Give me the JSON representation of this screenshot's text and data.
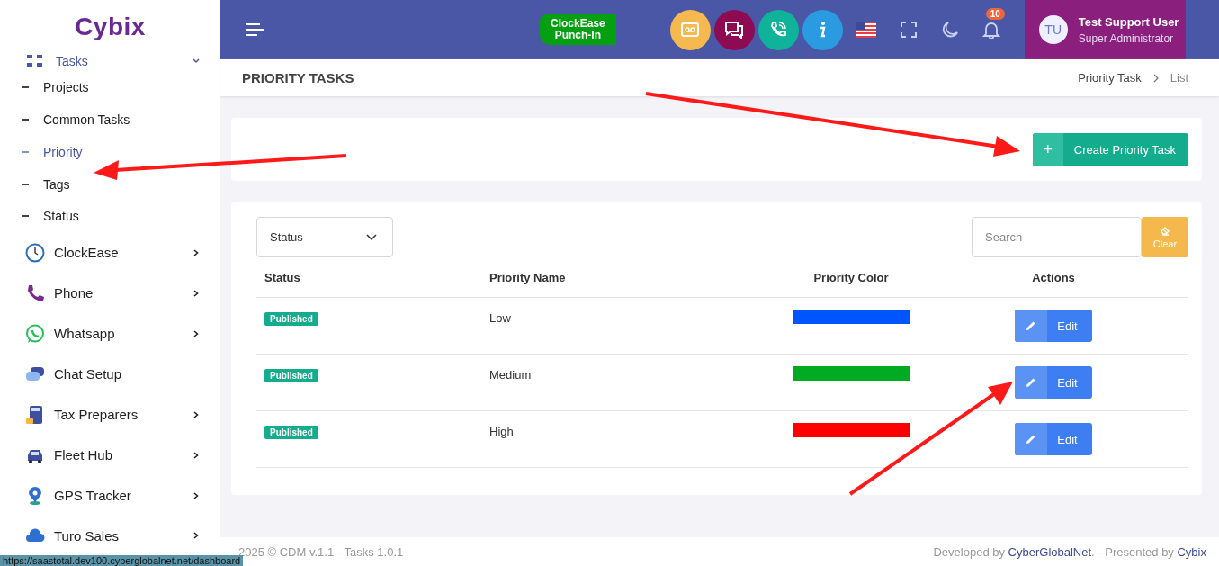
{
  "logo": "Cybix",
  "sidebar": {
    "group": {
      "label": "Tasks",
      "expanded": true,
      "children": [
        {
          "label": "Projects",
          "selected": false
        },
        {
          "label": "Common Tasks",
          "selected": false
        },
        {
          "label": "Priority",
          "selected": true
        },
        {
          "label": "Tags",
          "selected": false
        },
        {
          "label": "Status",
          "selected": false
        }
      ]
    },
    "items": [
      {
        "label": "ClockEase",
        "expandable": true
      },
      {
        "label": "Phone",
        "expandable": true
      },
      {
        "label": "Whatsapp",
        "expandable": true
      },
      {
        "label": "Chat Setup",
        "expandable": false
      },
      {
        "label": "Tax Preparers",
        "expandable": true
      },
      {
        "label": "Fleet Hub",
        "expandable": true
      },
      {
        "label": "GPS Tracker",
        "expandable": true
      },
      {
        "label": "Turo Sales",
        "expandable": true
      }
    ]
  },
  "topbar": {
    "punch_in": [
      "ClockEase",
      "Punch-In"
    ],
    "notifications": "10",
    "user": {
      "initials": "TU",
      "name": "Test Support User",
      "role": "Super Administrator"
    }
  },
  "page": {
    "title": "PRIORITY TASKS",
    "breadcrumb": [
      "Priority Task",
      "List"
    ]
  },
  "create_button": {
    "icon": "+",
    "label": "Create Priority Task"
  },
  "filter": {
    "value": "Status"
  },
  "search": {
    "placeholder": "Search"
  },
  "clear_button": "Clear",
  "table": {
    "columns": [
      "Status",
      "Priority Name",
      "Priority Color",
      "Actions"
    ],
    "rows": [
      {
        "status": "Published",
        "name": "Low",
        "color": "#0055ff",
        "action": "Edit"
      },
      {
        "status": "Published",
        "name": "Medium",
        "color": "#00aa22",
        "action": "Edit"
      },
      {
        "status": "Published",
        "name": "High",
        "color": "#ff0000",
        "action": "Edit"
      }
    ]
  },
  "footer": {
    "left": "2025 © CDM v.1.1 - Tasks 1.0.1",
    "prefix": "Developed by",
    "link1": "CyberGlobalNet",
    "middle": ". - Presented by",
    "link2": "Cybix"
  },
  "status_url": "https://saastotal.dev100.cyberglobalnet.net/dashboard"
}
